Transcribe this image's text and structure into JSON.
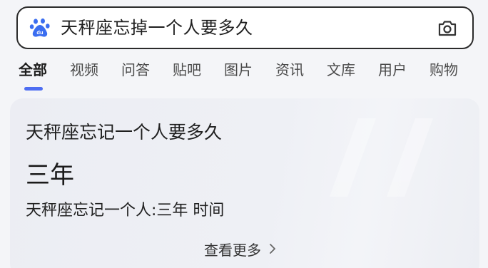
{
  "search": {
    "query": "天秤座忘掉一个人要多久"
  },
  "tabs": [
    {
      "label": "全部",
      "active": true
    },
    {
      "label": "视频"
    },
    {
      "label": "问答"
    },
    {
      "label": "贴吧"
    },
    {
      "label": "图片"
    },
    {
      "label": "资讯"
    },
    {
      "label": "文库"
    },
    {
      "label": "用户"
    },
    {
      "label": "购物"
    }
  ],
  "result_card": {
    "title": "天秤座忘记一个人要多久",
    "answer": "三年",
    "detail": "天秤座忘记一个人:三年 时间",
    "more_label": "查看更多"
  },
  "colors": {
    "accent": "#4e6ef2",
    "logo_blue": "#3a6df0"
  }
}
